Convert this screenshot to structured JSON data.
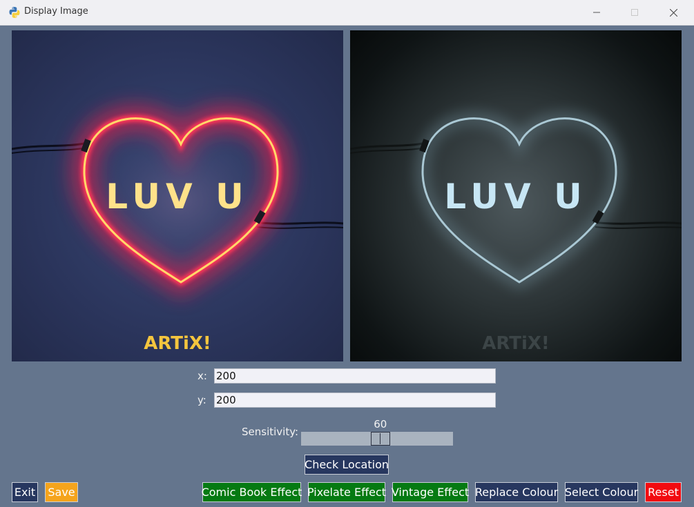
{
  "window": {
    "title": "Display Image",
    "icon": "python-icon",
    "controls": {
      "minimize": "minimize-icon",
      "maximize": "maximize-icon",
      "close": "close-icon"
    }
  },
  "images": {
    "original": {
      "caption": "LUV U",
      "logo": "ARTiX!"
    },
    "processed": {
      "caption": "LUV U",
      "logo": "ARTiX!"
    }
  },
  "coords": {
    "x_label": "x:",
    "x_value": "200",
    "y_label": "y:",
    "y_value": "200"
  },
  "sensitivity": {
    "label": "Sensitivity:",
    "value": 60,
    "value_text": "60",
    "min": 0,
    "max": 255
  },
  "buttons": {
    "check_location": "Check Location",
    "exit": "Exit",
    "save": "Save",
    "comic": "Comic Book Effect",
    "pixelate": "Pixelate Effect",
    "vintage": "Vintage Effect",
    "replace": "Replace Colour",
    "select": "Select Colour",
    "reset": "Reset"
  },
  "colors": {
    "background": "#64758d",
    "navy_button": "#27375f",
    "orange_button": "#f5a41c",
    "green_button": "#057a12",
    "red_button": "#f20b10"
  }
}
